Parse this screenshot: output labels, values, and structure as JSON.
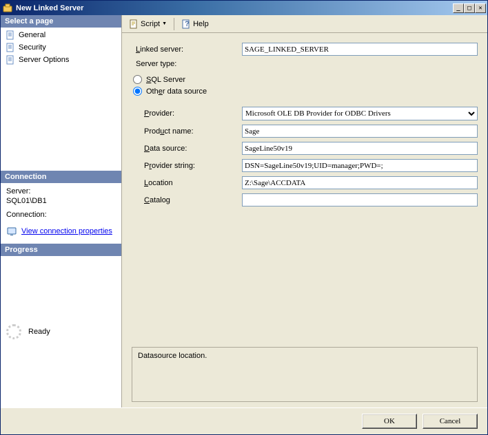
{
  "window": {
    "title": "New Linked Server"
  },
  "toolbar": {
    "script": "Script",
    "help": "Help"
  },
  "sidebar": {
    "header": "Select a page",
    "items": [
      {
        "label": "General"
      },
      {
        "label": "Security"
      },
      {
        "label": "Server Options"
      }
    ],
    "connection": {
      "header": "Connection",
      "server_label": "Server:",
      "server_value": "SQL01\\DB1",
      "conn_label": "Connection:",
      "conn_value": "",
      "view_link": "View connection properties"
    },
    "progress": {
      "header": "Progress",
      "status": "Ready"
    }
  },
  "form": {
    "linked_server_label": "Linked server:",
    "linked_server_value": "SAGE_LINKED_SERVER",
    "server_type_label": "Server type:",
    "radio_sql": "SQL Server",
    "radio_other": "Other data source",
    "provider_label": "Provider:",
    "provider_value": "Microsoft OLE DB Provider for ODBC Drivers",
    "product_label": "Product name:",
    "product_value": "Sage",
    "datasource_label": "Data source:",
    "datasource_value": "SageLine50v19",
    "provstr_label": "Provider string:",
    "provstr_value": "DSN=SageLine50v19;UID=manager;PWD=;",
    "location_label": "Location",
    "location_value": "Z:\\Sage\\ACCDATA",
    "catalog_label": "Catalog",
    "catalog_value": ""
  },
  "help": {
    "text": "Datasource location."
  },
  "buttons": {
    "ok": "OK",
    "cancel": "Cancel"
  }
}
